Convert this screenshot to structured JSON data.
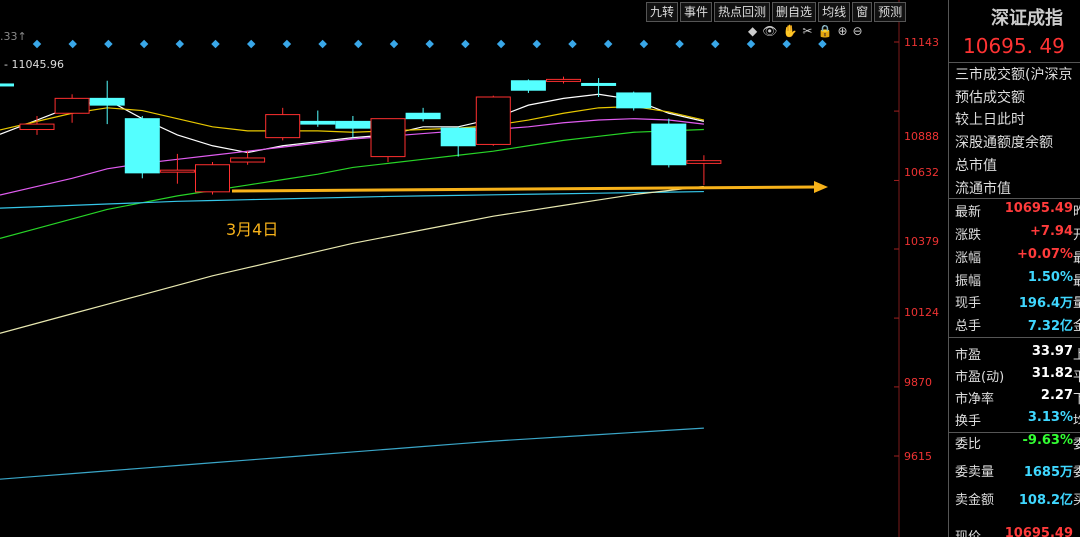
{
  "toolbar": {
    "buttons": [
      "九转",
      "事件",
      "热点回测",
      "删自选",
      "均线",
      "窗",
      "预测"
    ]
  },
  "top_left_value": ".33↑",
  "ma_label": "- 11045.96",
  "annotation": "3月4日",
  "price_axis": [
    "11143",
    "10888",
    "10632",
    "10379",
    "10124",
    "9870",
    "9615"
  ],
  "side": {
    "title": "深证成指",
    "price": "10695. 49",
    "labels": [
      "三市成交额(沪深京",
      "预估成交额",
      "较上日此时",
      "深股通额度余额",
      "总市值",
      "流通市值"
    ],
    "rows": [
      {
        "k": "最新",
        "v": "10695.49",
        "t": "昨",
        "color": "#ff3b3b"
      },
      {
        "k": "涨跌",
        "v": "+7.94",
        "t": "开",
        "color": "#ff3b3b"
      },
      {
        "k": "涨幅",
        "v": "+0.07%",
        "t": "最",
        "color": "#ff3b3b"
      },
      {
        "k": "振幅",
        "v": "1.50%",
        "t": "最",
        "color": "#3fd7ff"
      },
      {
        "k": "现手",
        "v": "196.4万",
        "t": "量",
        "color": "#3fd7ff"
      },
      {
        "k": "总手",
        "v": "7.32亿",
        "t": "金",
        "color": "#3fd7ff"
      },
      {
        "k": "市盈",
        "v": "33.97",
        "t": "上",
        "color": "#ffffff"
      },
      {
        "k": "市盈(动)",
        "v": "31.82",
        "t": "平",
        "color": "#ffffff"
      },
      {
        "k": "市净率",
        "v": "2.27",
        "t": "下",
        "color": "#ffffff"
      },
      {
        "k": "换手",
        "v": "3.13%",
        "t": "均",
        "color": "#3fd7ff"
      },
      {
        "k": "委比",
        "v": "-9.63%",
        "t": "委",
        "color": "#33ff33"
      },
      {
        "k": "委卖量",
        "v": "1685万",
        "t": "委",
        "color": "#3fd7ff"
      },
      {
        "k": "卖金额",
        "v": "108.2亿",
        "t": "买",
        "color": "#3fd7ff"
      },
      {
        "k": "现价",
        "v": "10695.49",
        "t": "",
        "color": "#ff3b3b"
      }
    ]
  },
  "chart_data": {
    "type": "candlestick",
    "y_axis_labels": [
      11143,
      10888,
      10632,
      10379,
      10124,
      9870,
      9615
    ],
    "ylim": [
      9500,
      11200
    ],
    "candles": [
      {
        "open": 10840,
        "close": 10820,
        "high": 10870,
        "low": 10800,
        "up": true
      },
      {
        "open": 10880,
        "close": 10935,
        "high": 10950,
        "low": 10845,
        "up": true
      },
      {
        "open": 10935,
        "close": 10910,
        "high": 11000,
        "low": 10840,
        "up": false
      },
      {
        "open": 10860,
        "close": 10660,
        "high": 10870,
        "low": 10640,
        "up": false
      },
      {
        "open": 10670,
        "close": 10665,
        "high": 10730,
        "low": 10620,
        "up": true
      },
      {
        "open": 10590,
        "close": 10690,
        "high": 10700,
        "low": 10580,
        "up": true
      },
      {
        "open": 10700,
        "close": 10715,
        "high": 10740,
        "low": 10690,
        "up": true
      },
      {
        "open": 10790,
        "close": 10875,
        "high": 10900,
        "low": 10780,
        "up": true
      },
      {
        "open": 10840,
        "close": 10850,
        "high": 10890,
        "low": 10830,
        "up": false
      },
      {
        "open": 10850,
        "close": 10825,
        "high": 10870,
        "low": 10790,
        "up": false
      },
      {
        "open": 10860,
        "close": 10720,
        "high": 10860,
        "low": 10700,
        "up": true
      },
      {
        "open": 10880,
        "close": 10860,
        "high": 10900,
        "low": 10850,
        "up": false
      },
      {
        "open": 10825,
        "close": 10760,
        "high": 10830,
        "low": 10720,
        "up": false
      },
      {
        "open": 10765,
        "close": 10940,
        "high": 10945,
        "low": 10760,
        "up": true
      },
      {
        "open": 11000,
        "close": 10965,
        "high": 11005,
        "low": 10955,
        "up": false
      },
      {
        "open": 11005,
        "close": 11000,
        "high": 11015,
        "low": 10990,
        "up": true
      },
      {
        "open": 10990,
        "close": 10985,
        "high": 11010,
        "low": 10940,
        "up": false
      },
      {
        "open": 10955,
        "close": 10900,
        "high": 10960,
        "low": 10890,
        "up": false
      },
      {
        "open": 10840,
        "close": 10690,
        "high": 10860,
        "low": 10680,
        "up": false
      },
      {
        "open": 10705,
        "close": 10695,
        "high": 10725,
        "low": 10615,
        "up": true
      }
    ],
    "moving_averages": [
      {
        "color": "#ffffff",
        "values": [
          10855,
          10905,
          10930,
          10860,
          10800,
          10760,
          10735,
          10760,
          10775,
          10790,
          10800,
          10830,
          10830,
          10860,
          10910,
          10935,
          10950,
          10930,
          10880,
          10850
        ]
      },
      {
        "color": "#e8c800",
        "values": [
          10850,
          10880,
          10900,
          10890,
          10860,
          10830,
          10815,
          10815,
          10815,
          10810,
          10815,
          10820,
          10825,
          10835,
          10855,
          10880,
          10900,
          10905,
          10885,
          10855
        ]
      },
      {
        "color": "#e05cf0",
        "values": [
          10610,
          10640,
          10675,
          10695,
          10710,
          10725,
          10740,
          10755,
          10770,
          10785,
          10795,
          10805,
          10815,
          10820,
          10830,
          10845,
          10855,
          10860,
          10855,
          10840
        ]
      },
      {
        "color": "#27d427",
        "values": [
          10455,
          10490,
          10525,
          10550,
          10575,
          10595,
          10615,
          10635,
          10655,
          10680,
          10695,
          10710,
          10725,
          10740,
          10760,
          10780,
          10795,
          10810,
          10815,
          10820
        ]
      },
      {
        "color": "#35c6e8",
        "values": [
          10535,
          10540,
          10545,
          10550,
          10555,
          10558,
          10561,
          10564,
          10567,
          10570,
          10573,
          10575,
          10577,
          10579,
          10581,
          10583,
          10585,
          10587,
          10589,
          10591
        ]
      },
      {
        "color": "#e8e8b0",
        "values": [
          10105,
          10140,
          10175,
          10210,
          10245,
          10280,
          10310,
          10340,
          10370,
          10400,
          10425,
          10450,
          10475,
          10500,
          10520,
          10540,
          10560,
          10580,
          10595,
          10610
        ]
      },
      {
        "color": "#3aa6c8",
        "values": [
          9540,
          9550,
          9560,
          9570,
          9580,
          9590,
          9600,
          9610,
          9620,
          9630,
          9640,
          9650,
          9660,
          9670,
          9678,
          9686,
          9694,
          9702,
          9710,
          9718
        ]
      }
    ]
  }
}
